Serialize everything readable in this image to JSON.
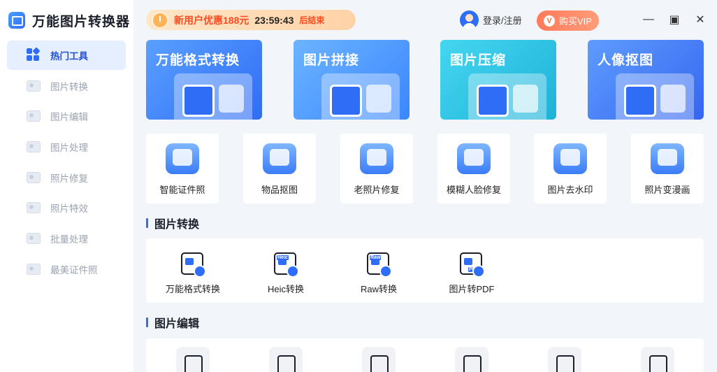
{
  "app": {
    "title": "万能图片转换器",
    "logo_icon": "picture-app-icon"
  },
  "sidebar": {
    "items": [
      {
        "label": "热门工具",
        "icon": "grid-icon",
        "active": true
      },
      {
        "label": "图片转换",
        "icon": "image-convert-icon"
      },
      {
        "label": "图片编辑",
        "icon": "image-edit-icon"
      },
      {
        "label": "图片处理",
        "icon": "image-process-icon"
      },
      {
        "label": "照片修复",
        "icon": "photo-repair-icon"
      },
      {
        "label": "照片特效",
        "icon": "photo-effect-icon"
      },
      {
        "label": "批量处理",
        "icon": "batch-icon"
      },
      {
        "label": "最美证件照",
        "icon": "id-photo-icon"
      }
    ]
  },
  "header": {
    "promo_text": "新用户优惠188元",
    "promo_time": "23:59:43",
    "promo_end": "后结束",
    "login_label": "登录/注册",
    "vip_label": "购买VIP",
    "vip_badge": "V",
    "minimize": "—",
    "maximize": "▣",
    "close": "✕"
  },
  "hero_cards": [
    {
      "title": "万能格式转换",
      "color": "#3f87ff"
    },
    {
      "title": "图片拼接",
      "color": "#4b9cff"
    },
    {
      "title": "图片压缩",
      "color": "#2ec4e6"
    },
    {
      "title": "人像抠图",
      "color": "#4a86ff"
    }
  ],
  "tools": [
    {
      "label": "智能证件照",
      "icon": "id-card-icon"
    },
    {
      "label": "物品抠图",
      "icon": "bag-icon"
    },
    {
      "label": "老照片修复",
      "icon": "wrench-photo-icon"
    },
    {
      "label": "模糊人脸修复",
      "icon": "face-portrait-icon"
    },
    {
      "label": "图片去水印",
      "icon": "eraser-icon"
    },
    {
      "label": "照片变漫画",
      "icon": "cartoon-bear-icon"
    }
  ],
  "section_convert": {
    "title": "图片转换",
    "items": [
      {
        "label": "万能格式转换",
        "icon": "format-convert-icon",
        "badge": ""
      },
      {
        "label": "Heic转换",
        "icon": "heic-convert-icon",
        "badge": "Heic"
      },
      {
        "label": "Raw转换",
        "icon": "raw-convert-icon",
        "badge": "Raw"
      },
      {
        "label": "图片转PDF",
        "icon": "image-to-pdf-icon",
        "badge": "PDF"
      }
    ]
  },
  "section_edit": {
    "title": "图片编辑",
    "icons": [
      "image-settings-icon",
      "crop-image-icon",
      "image-edit-pen-icon",
      "sticker-add-icon",
      "image-add-icon",
      "blend-circles-icon"
    ]
  }
}
